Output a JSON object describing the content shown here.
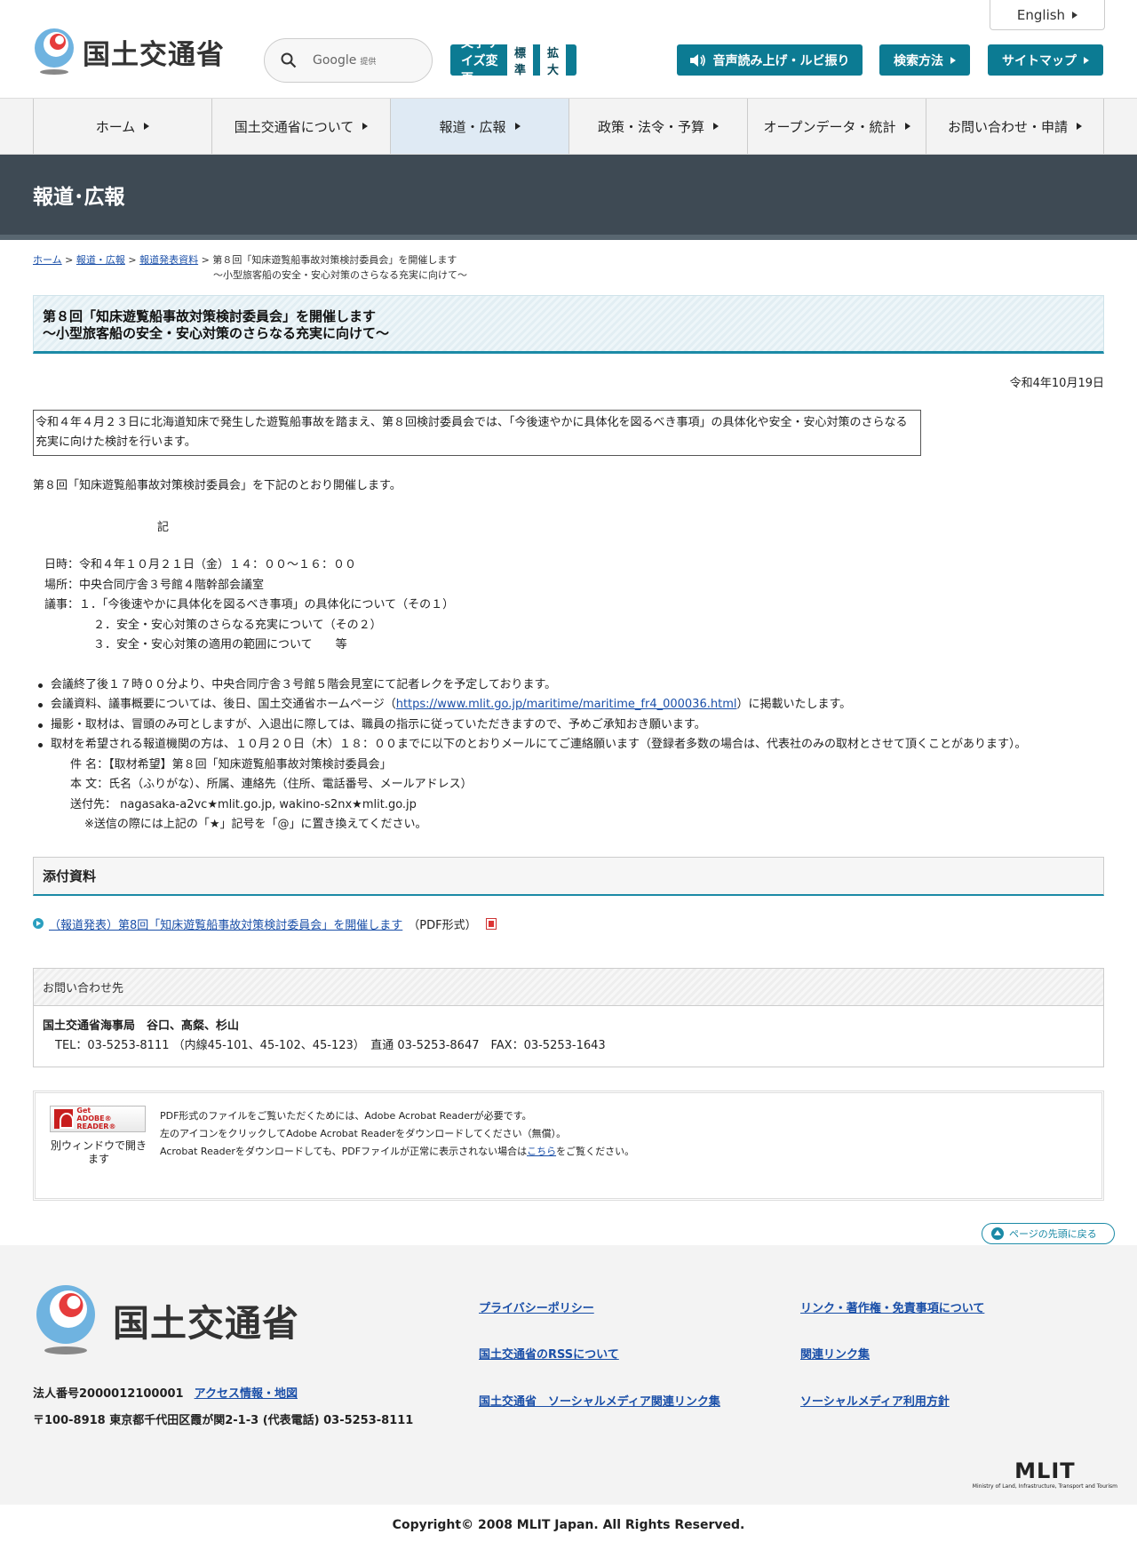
{
  "header": {
    "logo_text": "国土交通省",
    "lang_label": "English",
    "search_label": "Google",
    "search_sub": "提供",
    "font_size_label": "文字サイズ変更",
    "font_standard": "標準",
    "font_large": "拡大",
    "voice_label": "音声読み上げ・ルビ振り",
    "search_method_label": "検索方法",
    "sitemap_label": "サイトマップ"
  },
  "nav": [
    {
      "label": "ホーム"
    },
    {
      "label": "国土交通省について"
    },
    {
      "label": "報道・広報"
    },
    {
      "label": "政策・法令・予算"
    },
    {
      "label": "オープンデータ・統計"
    },
    {
      "label": "お問い合わせ・申請"
    }
  ],
  "page_title": "報道･広報",
  "breadcrumb": {
    "home": "ホーム",
    "press": "報道・広報",
    "release": "報道発表資料",
    "current1": "第８回「知床遊覧船事故対策検討委員会」を開催します",
    "current2": "～小型旅客船の安全・安心対策のさらなる充実に向けて～",
    "sep": ">"
  },
  "article": {
    "title1": "第８回「知床遊覧船事故対策検討委員会」を開催します",
    "title2": "～小型旅客船の安全・安心対策のさらなる充実に向けて～",
    "date": "令和4年10月19日",
    "lead": "令和４年４月２３日に北海道知床で発生した遊覧船事故を踏まえ、第８回検討委員会では、「今後速やかに具体化を図るべき事項」の具体化や安全・安心対策のさらなる充実に向けた検討を行います。",
    "intro": "第８回「知床遊覧船事故対策検討委員会」を下記のとおり開催します。",
    "ki": "記",
    "datetime": "日時：令和４年１０月２１日（金）１４：００～１６：００",
    "place": "場所：中央合同庁舎３号館４階幹部会議室",
    "agenda1": "議事：１．「今後速やかに具体化を図るべき事項」の具体化について（その１）",
    "agenda2": "２．安全・安心対策のさらなる充実について（その２）",
    "agenda3": "３．安全・安心対策の適用の範囲について　　等",
    "note1": "会議終了後１７時００分より、中央合同庁舎３号館５階会見室にて記者レクを予定しております。",
    "note2_pre": "会議資料、議事概要については、後日、国土交通省ホームページ（",
    "note2_link": "https://www.mlit.go.jp/maritime/maritime_fr4_000036.html",
    "note2_post": "）に掲載いたします。",
    "note3": "撮影・取材は、冒頭のみ可としますが、入退出に際しては、職員の指示に従っていただきますので、予めご承知おき願います。",
    "note4": "取材を希望される報道機関の方は、１０月２０日（木）１８：００までに以下のとおりメールにてご連絡願います（登録者多数の場合は、代表社のみの取材とさせて頂くことがあります）。",
    "mail_subject": "件 名：【取材希望】第８回「知床遊覧船事故対策検討委員会」",
    "mail_body": "本 文：氏名（ふりがな）、所属、連絡先（住所、電話番号、メールアドレス）",
    "mail_to": "送付先： nagasaka-a2vc★mlit.go.jp, wakino-s2nx★mlit.go.jp",
    "mail_note": "※送信の際には上記の「★」記号を「@」に置き換えてください。"
  },
  "attachments": {
    "heading": "添付資料",
    "link": "（報道発表）第8回「知床遊覧船事故対策検討委員会」を開催します",
    "format": "（PDF形式）"
  },
  "contact": {
    "heading": "お問い合わせ先",
    "org": "国土交通省海事局　谷口、髙粲、杉山",
    "tel": "TEL：03-5253-8111 （内線45-101、45-102、45-123）　直通 03-5253-8647　FAX：03-5253-1643"
  },
  "adobe": {
    "badge_line1": "Get",
    "badge_line2": "ADOBE® READER®",
    "window_note": "別ウィンドウで開きます",
    "text1": "PDF形式のファイルをご覧いただくためには、Adobe Acrobat Readerが必要です。",
    "text2": "左のアイコンをクリックしてAdobe Acrobat Readerをダウンロードしてください（無償）。",
    "text3_pre": "Acrobat Readerをダウンロードしても、PDFファイルが正常に表示されない場合は",
    "text3_link": "こちら",
    "text3_post": "をご覧ください。"
  },
  "pagetop_label": "ページの先頭に戻る",
  "footer": {
    "logo_text": "国土交通省",
    "corp_no": "法人番号2000012100001",
    "access": "アクセス情報・地図",
    "address": "〒100-8918 東京都千代田区霞が関2-1-3 (代表電話) 03-5253-8111",
    "links": [
      "プライバシーポリシー",
      "リンク・著作権・免責事項について",
      "国土交通省のRSSについて",
      "関連リンク集",
      "国土交通省　ソーシャルメディア関連リンク集",
      "ソーシャルメディア利用方針"
    ],
    "mlit_word": "MLIT",
    "mlit_sub": "Ministry of Land, Infrastructure, Transport and Tourism",
    "copyright": "Copyright© 2008 MLIT Japan. All Rights Reserved."
  },
  "colors": {
    "accent": "#0c7b93",
    "band": "#3e4a54"
  }
}
